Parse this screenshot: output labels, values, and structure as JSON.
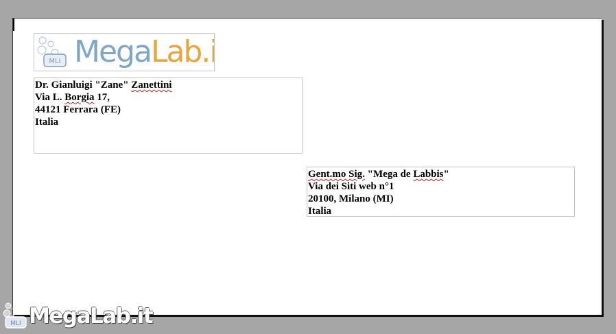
{
  "logo": {
    "badge": "MLI",
    "text_mega": "Mega",
    "text_lab": "Lab",
    "text_it": ".it",
    "colors": {
      "mega": "#7fa6c9",
      "lab": "#e7a53e"
    }
  },
  "sender": {
    "line1_prefix": "Dr. Gianluigi \"Zane\" ",
    "line1_surname": "Zanettini",
    "line2_prefix": "Via L. ",
    "line2_street": "Borgia",
    "line2_suffix": " 17,",
    "line3": "44121 Ferrara (FE)",
    "line4": "Italia"
  },
  "recipient": {
    "line1_salutation": "Gent.mo Sig.",
    "line1_mid": " \"Mega de ",
    "line1_name": "Labbis",
    "line1_end": "\"",
    "line2": "Via dei Siti web n°1",
    "line3": "20100, Milano (MI)",
    "line4": "Italia"
  },
  "watermark": {
    "badge": "MLI",
    "text": "MegaLab.it"
  }
}
